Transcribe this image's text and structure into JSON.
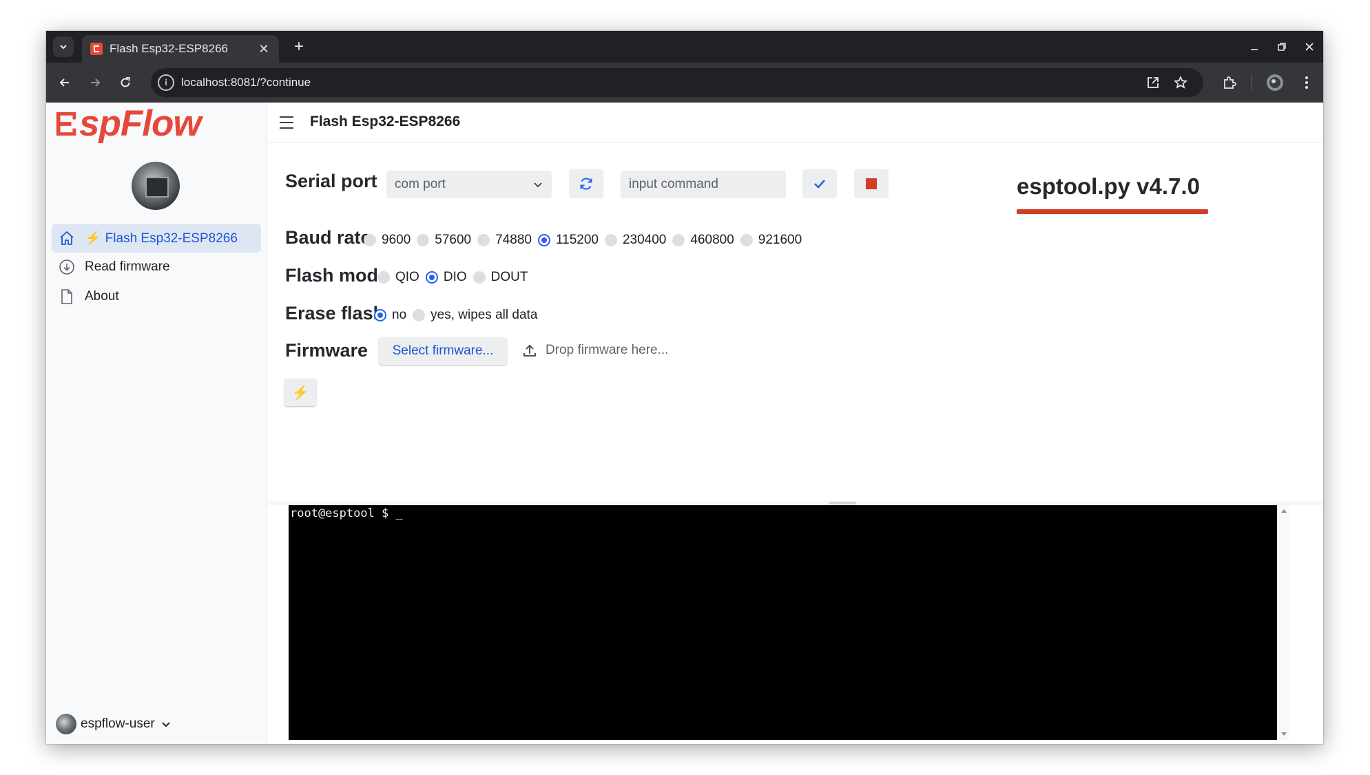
{
  "browser": {
    "tab_title": "Flash Esp32-ESP8266",
    "url": "localhost:8081/?continue"
  },
  "sidebar": {
    "logo_text": "spFlow",
    "items": [
      {
        "label": "Flash Esp32-ESP8266",
        "icon": "home-icon",
        "active": true
      },
      {
        "label": "Read firmware",
        "icon": "download-circle-icon",
        "active": false
      },
      {
        "label": "About",
        "icon": "document-icon",
        "active": false
      }
    ],
    "user": {
      "name": "espflow-user"
    }
  },
  "header": {
    "title": "Flash Esp32-ESP8266"
  },
  "form": {
    "serial_port": {
      "label": "Serial port",
      "select_value": "com port",
      "command_placeholder": "input command"
    },
    "baud_rate": {
      "label": "Baud rate",
      "options": [
        "9600",
        "57600",
        "74880",
        "115200",
        "230400",
        "460800",
        "921600"
      ],
      "selected": "115200"
    },
    "flash_mode": {
      "label": "Flash mode",
      "options": [
        "QIO",
        "DIO",
        "DOUT"
      ],
      "selected": "DIO"
    },
    "erase_flash": {
      "label": "Erase flash",
      "options": [
        "no",
        "yes, wipes all data"
      ],
      "selected": "no"
    },
    "firmware": {
      "label": "Firmware",
      "select_button": "Select firmware...",
      "drop_text": "Drop firmware here..."
    }
  },
  "version": "esptool.py v4.7.0",
  "terminal": {
    "prompt": "root@esptool $ _"
  },
  "colors": {
    "accent": "#e5473b",
    "primary": "#2563eb",
    "version_underline": "#cf3f27",
    "stop": "#cf3f27",
    "bolt": "#f5b400"
  }
}
